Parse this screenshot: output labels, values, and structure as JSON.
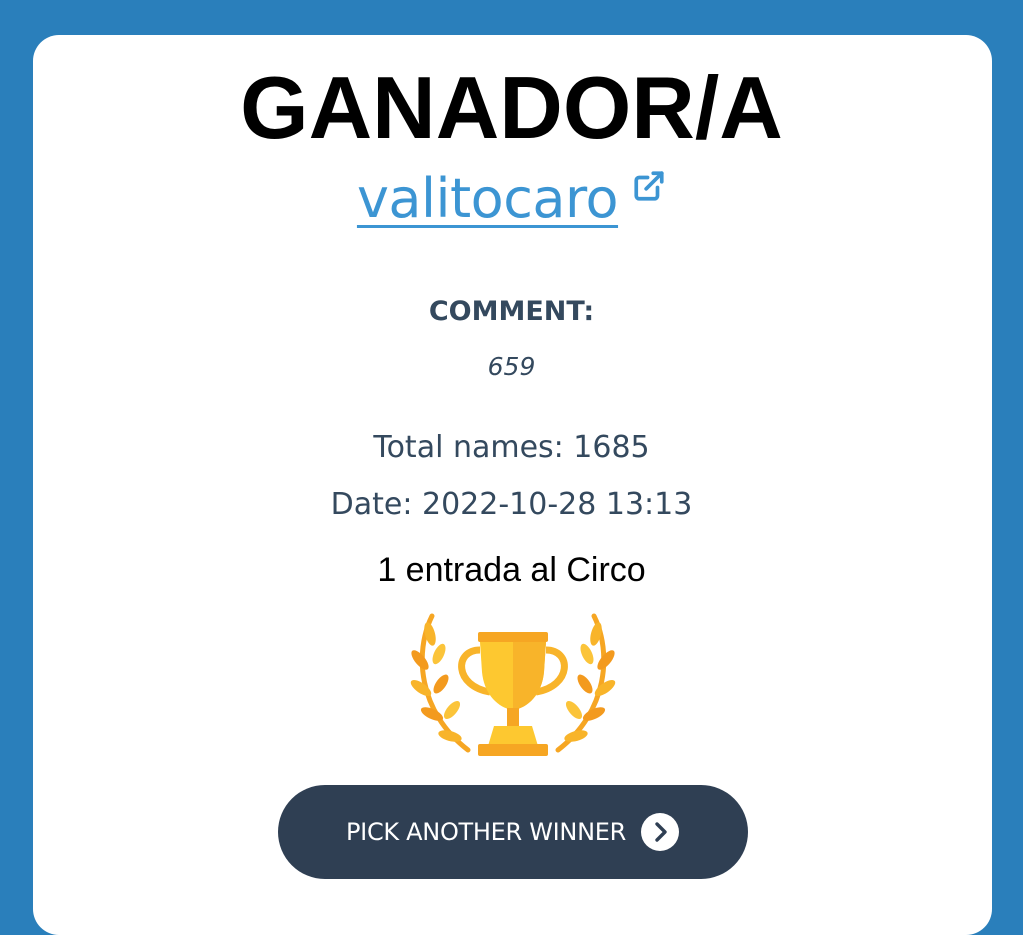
{
  "winner_card": {
    "heading": "GANADOR/A",
    "winner_name": "valitocaro",
    "comment_label": "COMMENT:",
    "comment_value": "659",
    "total_names": "Total names: 1685",
    "date": "Date: 2022-10-28 13:13",
    "prize": "1 entrada al Circo",
    "trophy_icon": "trophy-with-laurels-icon",
    "external_link_icon": "external-link-icon"
  },
  "actions": {
    "pick_another_label": "PICK ANOTHER WINNER",
    "pick_another_icon": "chevron-right-circle-icon"
  },
  "colors": {
    "background": "#2a7fbb",
    "link": "#3c95d3",
    "text": "#34495e",
    "button": "#2f3f53"
  }
}
